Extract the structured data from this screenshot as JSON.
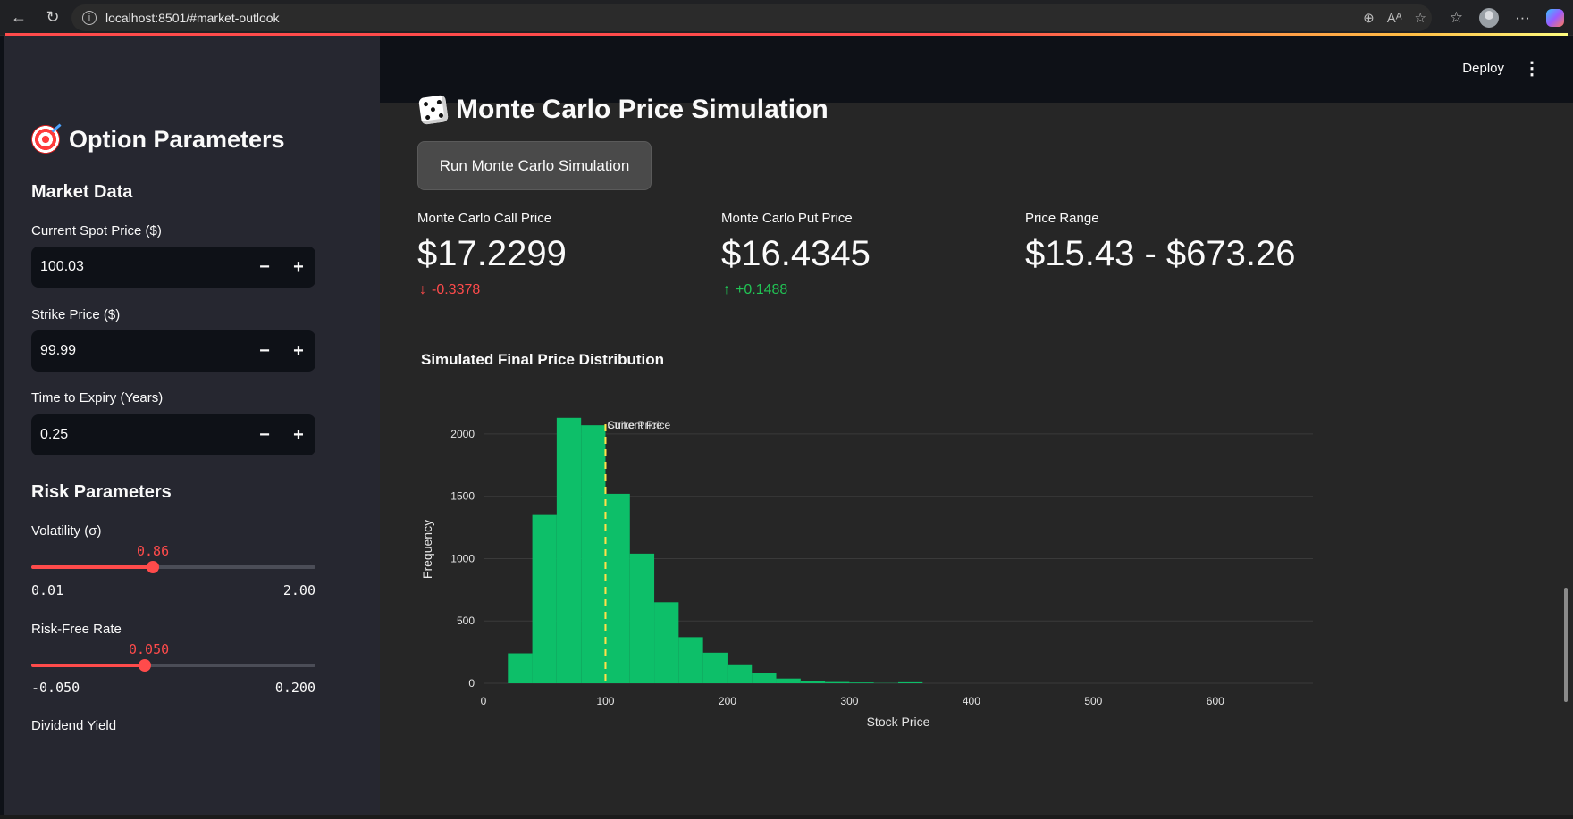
{
  "browser": {
    "url": "localhost:8501/#market-outlook"
  },
  "sidebar": {
    "title": "Option Parameters",
    "market_data_heading": "Market Data",
    "spot_label": "Current Spot Price ($)",
    "spot_value": "100.03",
    "strike_label": "Strike Price ($)",
    "strike_value": "99.99",
    "expiry_label": "Time to Expiry (Years)",
    "expiry_value": "0.25",
    "risk_heading": "Risk Parameters",
    "volatility": {
      "label": "Volatility (σ)",
      "value": "0.86",
      "min": "0.01",
      "max": "2.00",
      "fraction": 0.427
    },
    "rate": {
      "label": "Risk-Free Rate",
      "value": "0.050",
      "min": "-0.050",
      "max": "0.200",
      "fraction": 0.4
    },
    "dividend_label": "Dividend Yield",
    "minus": "−",
    "plus": "+"
  },
  "header": {
    "deploy_label": "Deploy",
    "menu_icon": "kebab-menu-icon"
  },
  "main": {
    "title": "Monte Carlo Price Simulation",
    "run_button": "Run Monte Carlo Simulation",
    "metrics": [
      {
        "label": "Monte Carlo Call Price",
        "value": "$17.2299",
        "delta": "-0.3378",
        "direction": "down"
      },
      {
        "label": "Monte Carlo Put Price",
        "value": "$16.4345",
        "delta": "+0.1488",
        "direction": "up"
      },
      {
        "label": "Price Range",
        "value": "$15.43 - $673.26",
        "delta": "",
        "direction": ""
      }
    ],
    "chart_title": "Simulated Final Price Distribution"
  },
  "colors": {
    "accent": "#ff4b4b",
    "bar": "#0dbf69",
    "up": "#21c354",
    "vline": "#ffe14a"
  },
  "chart_data": {
    "type": "bar",
    "title": "Simulated Final Price Distribution",
    "xlabel": "Stock Price",
    "ylabel": "Frequency",
    "xlim": [
      0,
      680
    ],
    "ylim": [
      0,
      2150
    ],
    "x_ticks": [
      0,
      100,
      200,
      300,
      400,
      500,
      600
    ],
    "y_ticks": [
      0,
      500,
      1000,
      1500,
      2000
    ],
    "bin_width": 20,
    "bin_starts": [
      20,
      40,
      60,
      80,
      100,
      120,
      140,
      160,
      180,
      200,
      220,
      240,
      260,
      280,
      300,
      320,
      340
    ],
    "values": [
      240,
      1350,
      2130,
      2070,
      1520,
      1040,
      650,
      370,
      245,
      145,
      85,
      38,
      18,
      10,
      6,
      2,
      8
    ],
    "grid": true,
    "annotations": [
      {
        "x": 100,
        "label": "Current Price"
      },
      {
        "x": 100,
        "label": "Strike Price"
      }
    ]
  }
}
